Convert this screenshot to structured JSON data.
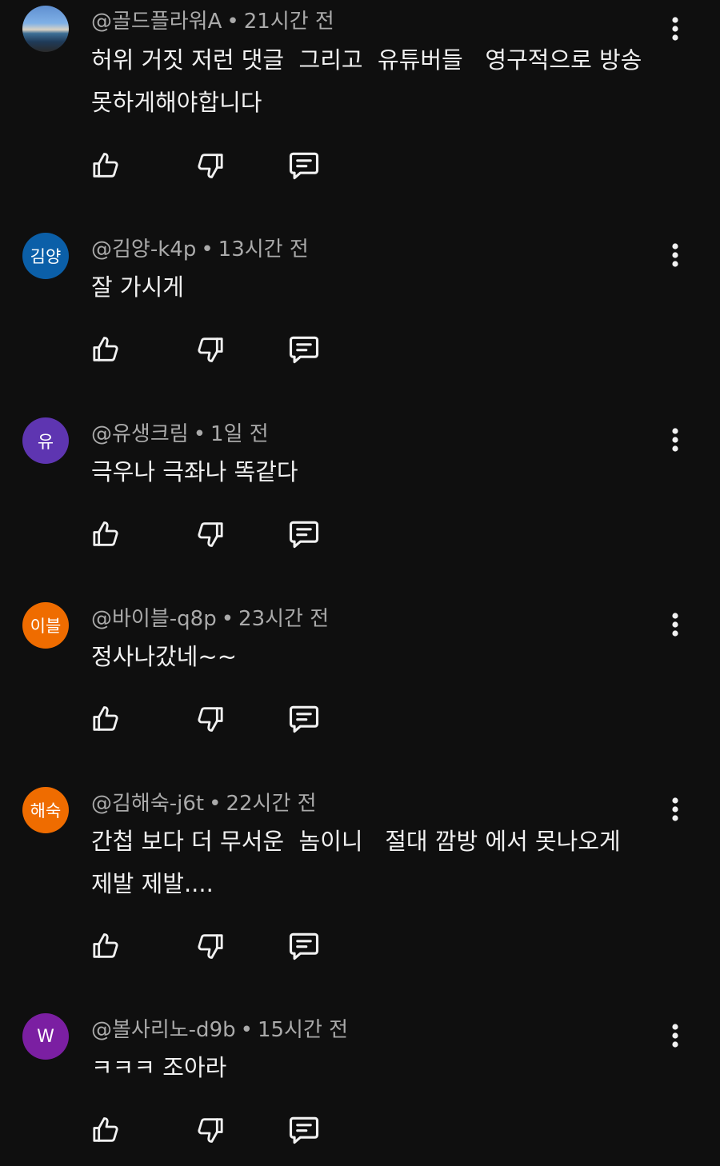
{
  "comments": [
    {
      "avatar_type": "photo",
      "avatar_text": "",
      "avatar_color": "#5f8fd0",
      "author": "@골드플라워A",
      "separator": "•",
      "time": "21시간 전",
      "text": "허위 거짓 저런 댓글  그리고  유튜버들   영구적으로 방송\n못하게해야합니다"
    },
    {
      "avatar_type": "initials",
      "avatar_text": "김양",
      "avatar_color": "#0b5fa8",
      "author": "@김양-k4p",
      "separator": "•",
      "time": "13시간 전",
      "text": "잘 가시게"
    },
    {
      "avatar_type": "initials",
      "avatar_text": "유",
      "avatar_color": "#5e35b1",
      "author": "@유생크림",
      "separator": "•",
      "time": "1일 전",
      "text": "극우나 극좌나 똑같다"
    },
    {
      "avatar_type": "initials",
      "avatar_text": "이블",
      "avatar_color": "#ef6c00",
      "author": "@바이블-q8p",
      "separator": "•",
      "time": "23시간 전",
      "text": "정사나갔네~~"
    },
    {
      "avatar_type": "initials",
      "avatar_text": "해숙",
      "avatar_color": "#ef6c00",
      "author": "@김해숙-j6t",
      "separator": "•",
      "time": "22시간 전",
      "text": "간첩 보다 더 무서운  놈이니   절대 깜방 에서 못나오게\n제발 제발...."
    },
    {
      "avatar_type": "initials",
      "avatar_text": "W",
      "avatar_color": "#7b1fa2",
      "author": "@볼사리노-d9b",
      "separator": "•",
      "time": "15시간 전",
      "text": "ㅋㅋㅋ 조아라"
    }
  ],
  "icons": {
    "like": "thumb-up-icon",
    "dislike": "thumb-down-icon",
    "reply": "reply-icon",
    "menu": "more-vert-icon"
  },
  "colors": {
    "background": "#0f0f0f",
    "text": "#f1f1f1",
    "meta": "#aaaaaa"
  }
}
